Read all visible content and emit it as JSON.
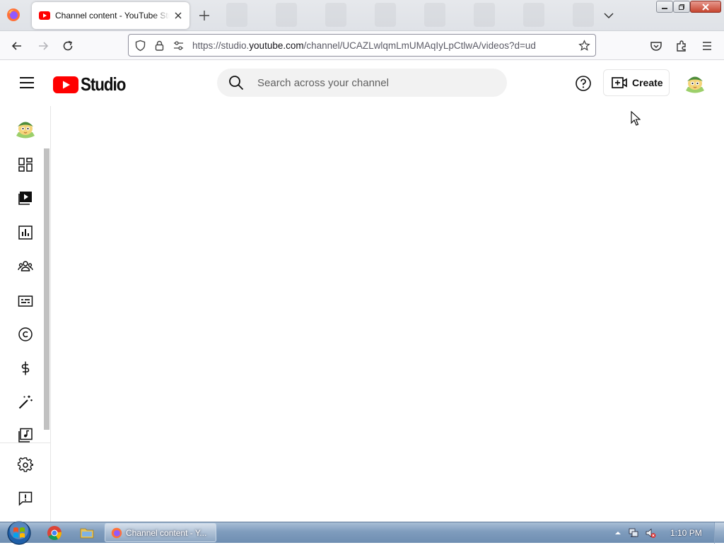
{
  "browser": {
    "tab": {
      "title": "Channel content - YouTube Studio",
      "favicon": "youtube-favicon"
    },
    "url": {
      "prefix": "https://studio.",
      "domain": "youtube.com",
      "path": "/channel/UCAZLwlqmLmUMAqIyLpCtlwA/videos?d=ud"
    },
    "icons": [
      "firefox-logo-icon",
      "new-tab-icon",
      "list-tabs-icon",
      "back-icon",
      "forward-icon",
      "reload-icon",
      "shield-icon",
      "lock-icon",
      "permissions-icon",
      "bookmark-star-icon",
      "pocket-icon",
      "extensions-icon",
      "menu-icon"
    ]
  },
  "studio": {
    "logo_text": "Studio",
    "search": {
      "placeholder": "Search across your channel"
    },
    "create_label": "Create",
    "colors": {
      "brand_red": "#ff0000",
      "text": "#0f0f0f",
      "search_bg": "#f2f2f2"
    }
  },
  "sidebar": {
    "items": [
      {
        "name": "channel-avatar",
        "icon": "avatar-icon"
      },
      {
        "name": "dashboard",
        "icon": "dashboard-icon"
      },
      {
        "name": "content",
        "icon": "content-icon",
        "active": true
      },
      {
        "name": "analytics",
        "icon": "analytics-icon"
      },
      {
        "name": "community",
        "icon": "community-icon"
      },
      {
        "name": "subtitles",
        "icon": "subtitles-icon"
      },
      {
        "name": "copyright",
        "icon": "copyright-icon"
      },
      {
        "name": "earn",
        "icon": "dollar-icon"
      },
      {
        "name": "customization",
        "icon": "magic-wand-icon"
      },
      {
        "name": "audio-library",
        "icon": "audio-library-icon"
      },
      {
        "name": "settings",
        "icon": "gear-icon"
      },
      {
        "name": "send-feedback",
        "icon": "feedback-icon"
      }
    ]
  },
  "taskbar": {
    "active_task": "Channel content - Y...",
    "clock": "1:10 PM"
  }
}
